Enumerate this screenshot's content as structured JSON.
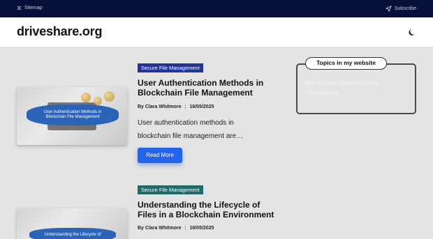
{
  "topbar": {
    "sitemap_label": "Sitemap",
    "subscribe_label": "Subscribe"
  },
  "header": {
    "logo": "driveshare.org"
  },
  "posts": [
    {
      "category": "Secure File Management",
      "title": "User Authentication Methods in Blockchain File Management",
      "author": "By Clara Whitmore",
      "separator": "|",
      "date": "16/05/2025",
      "excerpt": "User authentication methods in blockchain file management are…",
      "read_more": "Read More",
      "thumb_caption": "User Authentication Methods in Blockchain File Management"
    },
    {
      "category": "Secure File Management",
      "title": "Understanding the Lifecycle of Files in a Blockchain Environment",
      "author": "By Clara Whitmore",
      "separator": "|",
      "date": "16/05/2025",
      "thumb_caption": "Understanding the Lifecycle of"
    }
  ],
  "sidebar": {
    "label": "Topics in my website",
    "links": [
      "Blockchain Infrastructure Innovations"
    ]
  },
  "colors": {
    "topbar": "#07103a",
    "tag_blue": "#23339a",
    "tag_teal": "#1f6b6a",
    "button": "#2563eb"
  },
  "icons": {
    "sitemap": "shuffle-icon",
    "subscribe": "send-icon",
    "theme": "moon-icon"
  }
}
